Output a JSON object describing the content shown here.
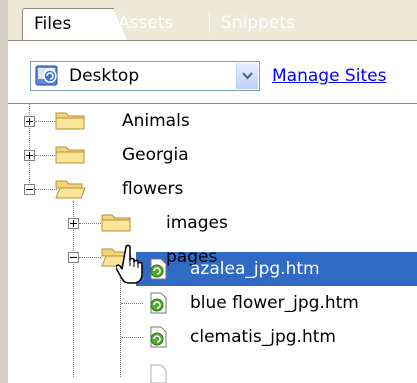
{
  "tabs": [
    {
      "label": "Files"
    },
    {
      "label": "Assets"
    },
    {
      "label": "Snippets"
    }
  ],
  "site_select": {
    "value": "Desktop"
  },
  "manage_sites_link": "Manage Sites",
  "tree": {
    "items": [
      {
        "label": "Animals",
        "type": "folder",
        "state": "collapsed"
      },
      {
        "label": "Georgia",
        "type": "folder",
        "state": "collapsed"
      },
      {
        "label": "flowers",
        "type": "folder",
        "state": "expanded"
      },
      {
        "label": "images",
        "type": "folder",
        "state": "collapsed"
      },
      {
        "label": "pages",
        "type": "folder",
        "state": "expanded"
      },
      {
        "label": "azalea_jpg.htm",
        "type": "file",
        "selected": true
      },
      {
        "label": "blue flower_jpg.htm",
        "type": "file"
      },
      {
        "label": "clematis_jpg.htm",
        "type": "file"
      }
    ]
  },
  "colors": {
    "selection": "#316ac5",
    "link": "#0000ff",
    "tab_bg": "#ece9d8"
  }
}
